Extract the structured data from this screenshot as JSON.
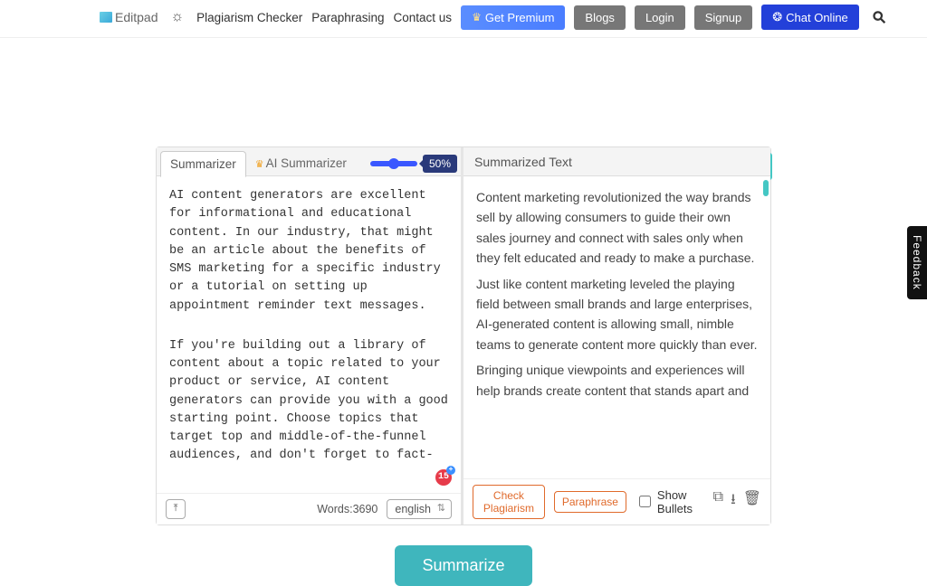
{
  "header": {
    "brand": "Editpad",
    "nav": {
      "plagiarism": "Plagiarism Checker",
      "paraphrasing": "Paraphrasing",
      "contact": "Contact us"
    },
    "buttons": {
      "premium": "Get Premium",
      "blogs": "Blogs",
      "login": "Login",
      "signup": "Signup",
      "chat": "Chat Online"
    }
  },
  "tool": {
    "tabs": {
      "summarizer": "Summarizer",
      "ai_summarizer": "AI Summarizer"
    },
    "slider_pct": "50%",
    "input_paragraphs": [
      "AI content generators are excellent for informational and educational content. In our industry, that might be an article about the benefits of SMS marketing for a specific industry or a tutorial on setting up appointment reminder text messages.",
      "If you're building out a library of content about a topic related to your product or service, AI content generators can provide you with a good starting point. Choose topics that target top and middle-of-the-funnel audiences, and don't forget to fact-"
    ],
    "words_label": "Words:",
    "words_count": "3690",
    "language": "english",
    "badge": "15",
    "output_header": "Summarized Text",
    "output_paragraphs": [
      "Content marketing revolutionized the way brands sell by allowing consumers to guide their own sales journey and connect with sales only when they felt educated and ready to make a purchase.",
      "Just like content marketing leveled the playing field between small brands and large enterprises, AI-generated content is allowing small, nimble teams to generate content more quickly than ever.",
      "Bringing unique viewpoints and experiences will help brands create content that stands apart and"
    ],
    "actions": {
      "check_plagiarism": "Check Plagiarism",
      "paraphrase": "Paraphrase",
      "show_bullets": "Show Bullets"
    },
    "summarize_btn": "Summarize"
  },
  "feedback": "Feedback"
}
